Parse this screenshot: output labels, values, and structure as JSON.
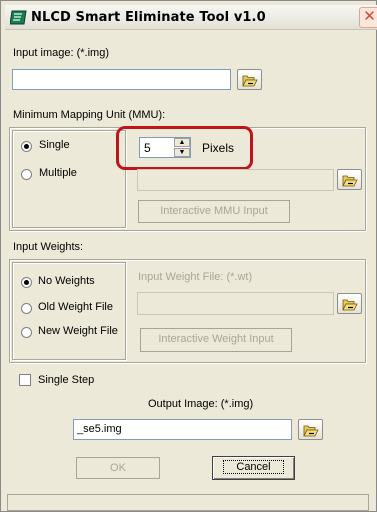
{
  "window": {
    "title": "NLCD Smart Eliminate Tool v1.0",
    "close_glyph": "✕"
  },
  "input_image": {
    "label": "Input image: (*.img)",
    "value": ""
  },
  "mmu": {
    "group_label": "Minimum Mapping Unit (MMU):",
    "options": [
      "Single",
      "Multiple"
    ],
    "selected": "Single",
    "value": "5",
    "unit_label": "Pixels",
    "file_value": "",
    "interactive_button": "Interactive MMU Input"
  },
  "weights": {
    "group_label": "Input Weights:",
    "options": [
      "No Weights",
      "Old Weight File",
      "New Weight File"
    ],
    "selected": "No Weights",
    "file_label": "Input Weight File: (*.wt)",
    "file_value": "",
    "interactive_button": "Interactive Weight Input"
  },
  "single_step": {
    "label": "Single Step",
    "checked": false
  },
  "output_image": {
    "label": "Output Image: (*.img)",
    "value": "_se5.img"
  },
  "buttons": {
    "ok": "OK",
    "cancel": "Cancel"
  },
  "colors": {
    "highlight": "#c0141b",
    "field_border": "#7f9db9",
    "disabled_text": "#a8a698"
  },
  "icons": [
    "app-icon",
    "folder-open-icon",
    "close-icon",
    "spin-up-icon",
    "spin-down-icon"
  ]
}
